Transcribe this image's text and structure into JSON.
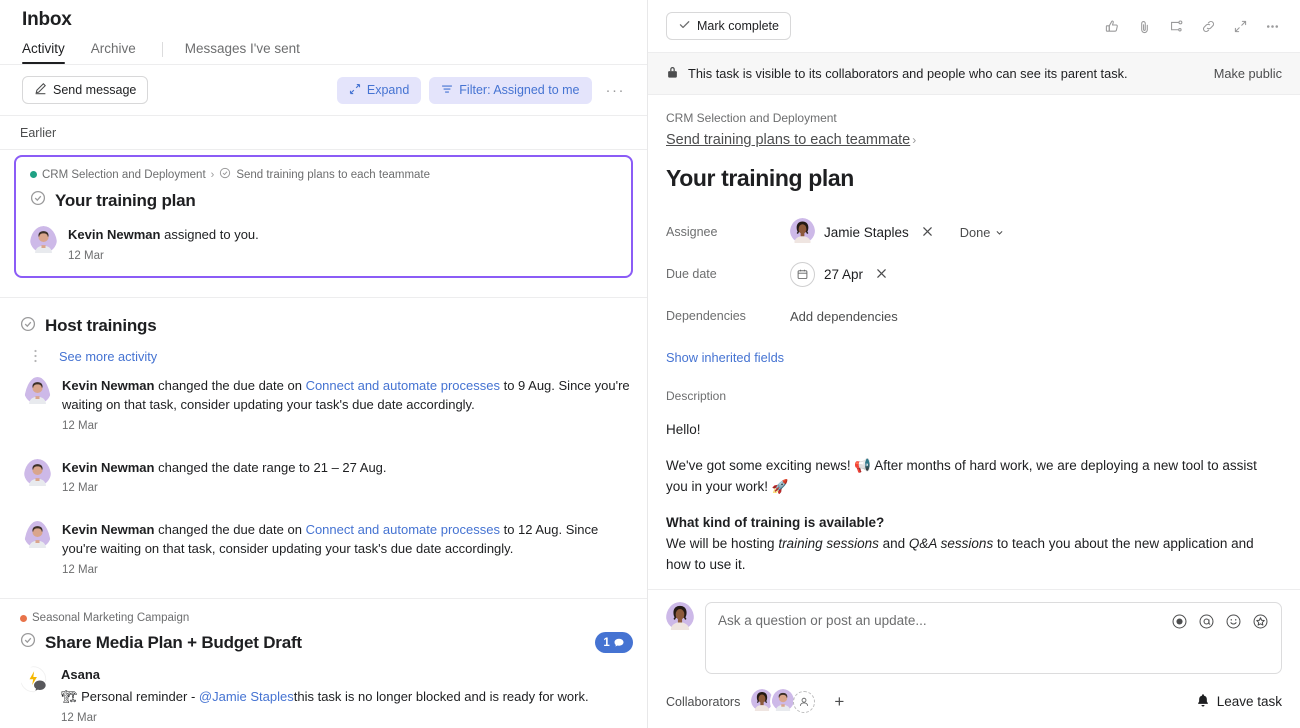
{
  "left": {
    "page_title": "Inbox",
    "tabs": [
      {
        "label": "Activity",
        "active": true
      },
      {
        "label": "Archive",
        "active": false
      },
      {
        "label": "Messages I've sent",
        "active": false
      }
    ],
    "toolbar": {
      "send_message_label": "Send message",
      "expand_label": "Expand",
      "filter_label": "Filter: Assigned to me",
      "more_label": "···"
    },
    "section_label": "Earlier",
    "selected_card": {
      "project": "CRM Selection and Deployment",
      "project_dot_color": "#1fa184",
      "separator": "›",
      "parent_task": "Send training plans to each teammate",
      "title": "Your training plan",
      "actor": "Kevin Newman",
      "event_text": " assigned to you.",
      "timestamp": "12 Mar",
      "border_color": "#8b5cf6"
    },
    "group": {
      "title": "Host trainings",
      "see_more_label": "See more activity",
      "events": [
        {
          "actor": "Kevin Newman",
          "text_before": " changed the due date on ",
          "link": "Connect and automate processes",
          "text_after": " to 9 Aug. Since you're waiting on that task, consider updating your task's due date accordingly.",
          "timestamp": "12 Mar"
        },
        {
          "actor": "Kevin Newman",
          "text_before": " changed the date range to 21 – 27 Aug.",
          "link": "",
          "text_after": "",
          "timestamp": "12 Mar"
        },
        {
          "actor": "Kevin Newman",
          "text_before": " changed the due date on ",
          "link": "Connect and automate processes",
          "text_after": " to 12 Aug. Since you're waiting on that task, consider updating your task's due date accordingly.",
          "timestamp": "12 Mar"
        }
      ]
    },
    "bottom_card": {
      "project": "Seasonal Marketing Campaign",
      "project_dot_color": "#e8734a",
      "title": "Share Media Plan + Budget Draft",
      "comment_count": "1",
      "actor": "Asana",
      "message_prefix": "🏗 Personal reminder - ",
      "mention": "@Jamie Staples",
      "message_suffix": "this task is no longer blocked and is ready for work.",
      "timestamp": "12 Mar"
    }
  },
  "right": {
    "header": {
      "mark_complete_label": "Mark complete",
      "icons": [
        "like-icon",
        "attachment-icon",
        "subtask-icon",
        "link-icon",
        "fullscreen-icon",
        "more-icon"
      ]
    },
    "notice": {
      "text": "This task is visible to its collaborators and people who can see its parent task.",
      "action_label": "Make public"
    },
    "breadcrumb": {
      "project": "CRM Selection and Deployment",
      "parent_task": "Send training plans to each teammate",
      "chevron": "›"
    },
    "task_title": "Your training plan",
    "fields": [
      {
        "label": "Assignee",
        "value": "Jamie Staples",
        "has_avatar": true,
        "has_clear": true,
        "extra": "Done"
      },
      {
        "label": "Due date",
        "value": "27 Apr",
        "has_avatar": false,
        "has_clear": true,
        "extra": ""
      },
      {
        "label": "Dependencies",
        "value": "Add dependencies",
        "has_avatar": false,
        "has_clear": false,
        "extra": ""
      }
    ],
    "show_inherited_label": "Show inherited fields",
    "description_label": "Description",
    "description": {
      "greeting": "Hello!",
      "p1": "We've got some exciting news! 📢 After months of hard work, we are deploying a new tool to assist you in your work! 🚀",
      "h1": "What kind of training is available?",
      "p2_a": "We will be hosting ",
      "p2_i1": "training sessions",
      "p2_b": " and ",
      "p2_i2": "Q&A sessions",
      "p2_c": " to teach you about the new application and how to use it."
    },
    "composer": {
      "placeholder": "Ask a question or post an update...",
      "icons": [
        "record-icon",
        "mention-icon",
        "emoji-icon",
        "sticker-icon"
      ]
    },
    "footer": {
      "collaborators_label": "Collaborators",
      "add_label": "+",
      "leave_label": "Leave task"
    }
  },
  "colors": {
    "accent_blue": "#4573d2",
    "lilac_bg": "#e4e4fb",
    "purple_border": "#8b5cf6",
    "avatar_bg": "#cdb9e8"
  }
}
